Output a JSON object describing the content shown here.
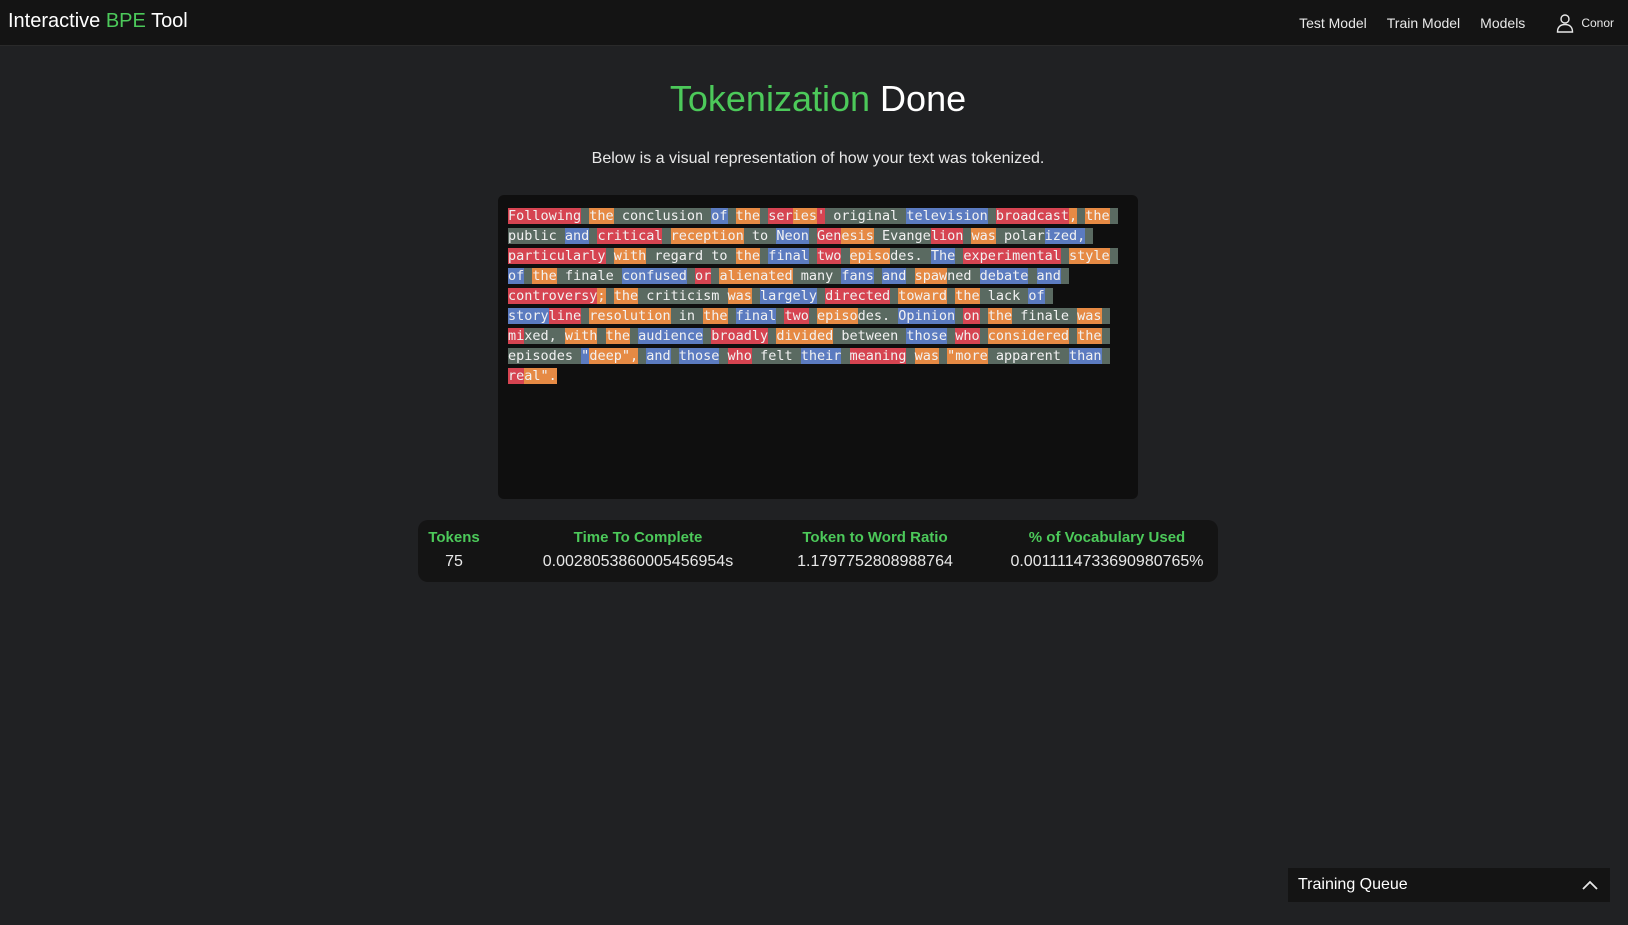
{
  "navbar": {
    "brand_prefix": "Interactive",
    "brand_accent": "BPE",
    "brand_suffix": "Tool",
    "links": [
      "Test Model",
      "Train Model",
      "Models"
    ],
    "user_name": "Conor",
    "user_icon": "user-icon"
  },
  "page": {
    "title_accent": "Tokenization",
    "title_rest": "Done",
    "subtitle": "Below is a visual representation of how your text was tokenized."
  },
  "colors": {
    "accent": "#4cc95a",
    "token_palette": [
      "#d64451",
      "#e68a44",
      "#5a6a61",
      "#5b7bc0"
    ]
  },
  "tokens": [
    [
      "Following",
      0
    ],
    [
      " ",
      2
    ],
    [
      "the",
      1
    ],
    [
      " ",
      2
    ],
    [
      "conclusion",
      2
    ],
    [
      " ",
      2
    ],
    [
      "of",
      3
    ],
    [
      " ",
      2
    ],
    [
      "the",
      1
    ],
    [
      " ",
      2
    ],
    [
      "ser",
      0
    ],
    [
      "ies",
      1
    ],
    [
      "'",
      0
    ],
    [
      " ",
      2
    ],
    [
      "original",
      2
    ],
    [
      " ",
      2
    ],
    [
      "television",
      3
    ],
    [
      " ",
      2
    ],
    [
      "broadcast",
      0
    ],
    [
      ",",
      1
    ],
    [
      " ",
      2
    ],
    [
      "the",
      1
    ],
    [
      " ",
      2
    ],
    [
      "public",
      2
    ],
    [
      " ",
      2
    ],
    [
      "and",
      3
    ],
    [
      " ",
      2
    ],
    [
      "critical",
      0
    ],
    [
      " ",
      2
    ],
    [
      "reception",
      1
    ],
    [
      " ",
      2
    ],
    [
      "to",
      2
    ],
    [
      " ",
      2
    ],
    [
      "Neon",
      3
    ],
    [
      " ",
      2
    ],
    [
      "Gen",
      0
    ],
    [
      "esis",
      1
    ],
    [
      " ",
      2
    ],
    [
      "Evange",
      2
    ],
    [
      "lion",
      0
    ],
    [
      " ",
      2
    ],
    [
      "was",
      1
    ],
    [
      " ",
      2
    ],
    [
      "polar",
      2
    ],
    [
      "ized,",
      3
    ],
    [
      " ",
      2
    ],
    [
      "particularly",
      0
    ],
    [
      " ",
      2
    ],
    [
      "with",
      1
    ],
    [
      " ",
      2
    ],
    [
      "regard",
      2
    ],
    [
      " ",
      2
    ],
    [
      "to",
      2
    ],
    [
      " ",
      2
    ],
    [
      "the",
      1
    ],
    [
      " ",
      2
    ],
    [
      "final",
      3
    ],
    [
      " ",
      2
    ],
    [
      "two",
      0
    ],
    [
      " ",
      2
    ],
    [
      "episo",
      1
    ],
    [
      "des.",
      2
    ],
    [
      " ",
      2
    ],
    [
      "The",
      3
    ],
    [
      " ",
      2
    ],
    [
      "experimental",
      0
    ],
    [
      " ",
      2
    ],
    [
      "style",
      1
    ],
    [
      " ",
      2
    ],
    [
      "of",
      3
    ],
    [
      " ",
      2
    ],
    [
      "the",
      1
    ],
    [
      " ",
      2
    ],
    [
      "finale",
      2
    ],
    [
      " ",
      2
    ],
    [
      "confused",
      3
    ],
    [
      " ",
      2
    ],
    [
      "or",
      0
    ],
    [
      " ",
      2
    ],
    [
      "alienated",
      1
    ],
    [
      " ",
      2
    ],
    [
      "many",
      2
    ],
    [
      " ",
      2
    ],
    [
      "fans",
      3
    ],
    [
      " ",
      2
    ],
    [
      "and",
      3
    ],
    [
      " ",
      2
    ],
    [
      "spaw",
      1
    ],
    [
      "ned",
      2
    ],
    [
      " ",
      2
    ],
    [
      "debate",
      3
    ],
    [
      " ",
      2
    ],
    [
      "and",
      3
    ],
    [
      " ",
      2
    ],
    [
      "controversy",
      0
    ],
    [
      ";",
      1
    ],
    [
      " ",
      2
    ],
    [
      "the",
      1
    ],
    [
      " ",
      2
    ],
    [
      "criticism",
      2
    ],
    [
      " ",
      2
    ],
    [
      "was",
      1
    ],
    [
      " ",
      2
    ],
    [
      "largely",
      3
    ],
    [
      " ",
      2
    ],
    [
      "directed",
      0
    ],
    [
      " ",
      2
    ],
    [
      "toward",
      1
    ],
    [
      " ",
      2
    ],
    [
      "the",
      1
    ],
    [
      " ",
      2
    ],
    [
      "lack",
      2
    ],
    [
      " ",
      2
    ],
    [
      "of",
      3
    ],
    [
      " ",
      2
    ],
    [
      "story",
      3
    ],
    [
      "line",
      0
    ],
    [
      " ",
      2
    ],
    [
      "resolution",
      1
    ],
    [
      " ",
      2
    ],
    [
      "in",
      2
    ],
    [
      " ",
      2
    ],
    [
      "the",
      1
    ],
    [
      " ",
      2
    ],
    [
      "final",
      3
    ],
    [
      " ",
      2
    ],
    [
      "two",
      0
    ],
    [
      " ",
      2
    ],
    [
      "episo",
      1
    ],
    [
      "des.",
      2
    ],
    [
      " ",
      2
    ],
    [
      "Opinion",
      3
    ],
    [
      " ",
      2
    ],
    [
      "on",
      0
    ],
    [
      " ",
      2
    ],
    [
      "the",
      1
    ],
    [
      " ",
      2
    ],
    [
      "finale",
      2
    ],
    [
      " ",
      2
    ],
    [
      "was",
      1
    ],
    [
      " ",
      2
    ],
    [
      "mi",
      0
    ],
    [
      "xed,",
      2
    ],
    [
      " ",
      2
    ],
    [
      "with",
      1
    ],
    [
      " ",
      2
    ],
    [
      "the",
      1
    ],
    [
      " ",
      2
    ],
    [
      "audience",
      3
    ],
    [
      " ",
      2
    ],
    [
      "broadly",
      0
    ],
    [
      " ",
      2
    ],
    [
      "divided",
      1
    ],
    [
      " ",
      2
    ],
    [
      "between",
      2
    ],
    [
      " ",
      2
    ],
    [
      "those",
      3
    ],
    [
      " ",
      2
    ],
    [
      "who",
      0
    ],
    [
      " ",
      2
    ],
    [
      "considered",
      1
    ],
    [
      " ",
      2
    ],
    [
      "the",
      1
    ],
    [
      " ",
      2
    ],
    [
      "episodes",
      2
    ],
    [
      " ",
      2
    ],
    [
      "\"",
      3
    ],
    [
      "deep\",",
      1
    ],
    [
      " ",
      2
    ],
    [
      "and",
      3
    ],
    [
      " ",
      2
    ],
    [
      "those",
      3
    ],
    [
      " ",
      2
    ],
    [
      "who",
      0
    ],
    [
      " ",
      2
    ],
    [
      "felt",
      2
    ],
    [
      " ",
      2
    ],
    [
      "their",
      3
    ],
    [
      " ",
      2
    ],
    [
      "meaning",
      0
    ],
    [
      " ",
      2
    ],
    [
      "was",
      1
    ],
    [
      " ",
      2
    ],
    [
      "\"more",
      1
    ],
    [
      " ",
      2
    ],
    [
      "apparent",
      2
    ],
    [
      " ",
      2
    ],
    [
      "than",
      3
    ],
    [
      " ",
      2
    ],
    [
      "re",
      0
    ],
    [
      "al\".",
      1
    ]
  ],
  "stats": [
    {
      "label": "Tokens",
      "value": "75"
    },
    {
      "label": "Time To Complete",
      "value": "0.0028053860005456954s"
    },
    {
      "label": "Token to Word Ratio",
      "value": "1.1797752808988764"
    },
    {
      "label": "% of Vocabulary Used",
      "value": "0.0011114733690980765%"
    }
  ],
  "queue": {
    "label": "Training Queue",
    "toggle_icon": "chevron-up-icon"
  }
}
